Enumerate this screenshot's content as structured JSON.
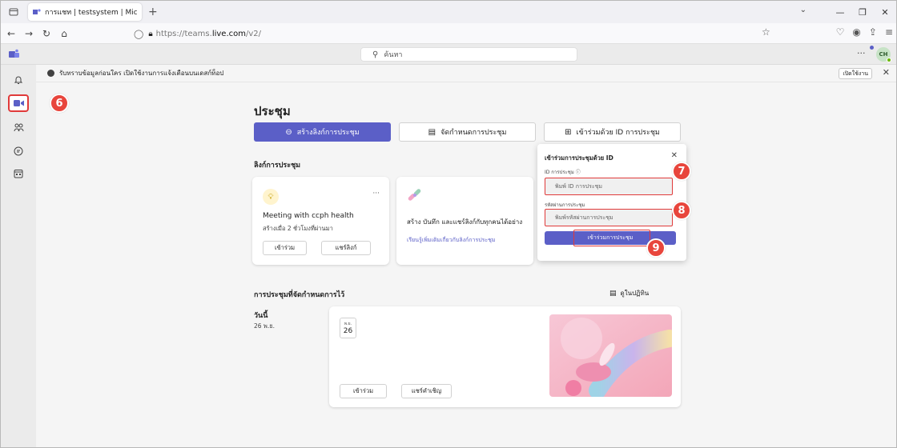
{
  "browser": {
    "tab_title": "การแชท | testsystem | Microsoft ×",
    "url_prefix": "https://teams.",
    "url_host": "live.com",
    "url_path": "/v2/"
  },
  "teams": {
    "search_placeholder": "ค้นหา",
    "avatar_initials": "CH"
  },
  "banner": {
    "text": "รับทราบข้อมูลก่อนใคร เปิดใช้งานการแจ้งเตือนบนเดสก์ท็อป",
    "button": "เปิดใช้งาน"
  },
  "page": {
    "title": "ประชุม",
    "btn_create_link": "สร้างลิงก์การประชุม",
    "btn_schedule": "จัดกำหนดการประชุม",
    "btn_join_id": "เข้าร่วมด้วย ID การประชุม",
    "section_links": "ลิงก์การประชุม",
    "section_scheduled": "การประชุมที่จัดกำหนดการไว้",
    "view_calendar": "ดูในปฏิทิน",
    "today_label": "วันนี้",
    "today_date": "26 พ.ย."
  },
  "meeting_card": {
    "title": "Meeting with ccph health",
    "subtitle": "สร้างเมื่อ 2 ชั่วโมงที่ผ่านมา",
    "join": "เข้าร่วม",
    "share": "แชร์ลิงก์"
  },
  "info_card": {
    "text": "สร้าง บันทึก และแชร์ลิงก์กับทุกคนได้อย่าง",
    "link": "เรียนรู้เพิ่มเติมเกี่ยวกับลิงก์การประชุม"
  },
  "scheduled_card": {
    "month": "พ.ย.",
    "day": "26",
    "join": "เข้าร่วม",
    "invite": "แชร์คำเชิญ"
  },
  "popup": {
    "title": "เข้าร่วมการประชุมด้วย ID",
    "id_label": "ID การประชุม ⓘ",
    "id_placeholder": "พิมพ์ ID การประชุม",
    "pass_label": "รหัสผ่านการประชุม",
    "pass_placeholder": "พิมพ์รหัสผ่านการประชุม",
    "join_button": "เข้าร่วมการประชุม"
  },
  "steps": [
    "6",
    "7",
    "8",
    "9"
  ],
  "colors": {
    "accent": "#5b5fc7",
    "marker": "#e8453c"
  }
}
